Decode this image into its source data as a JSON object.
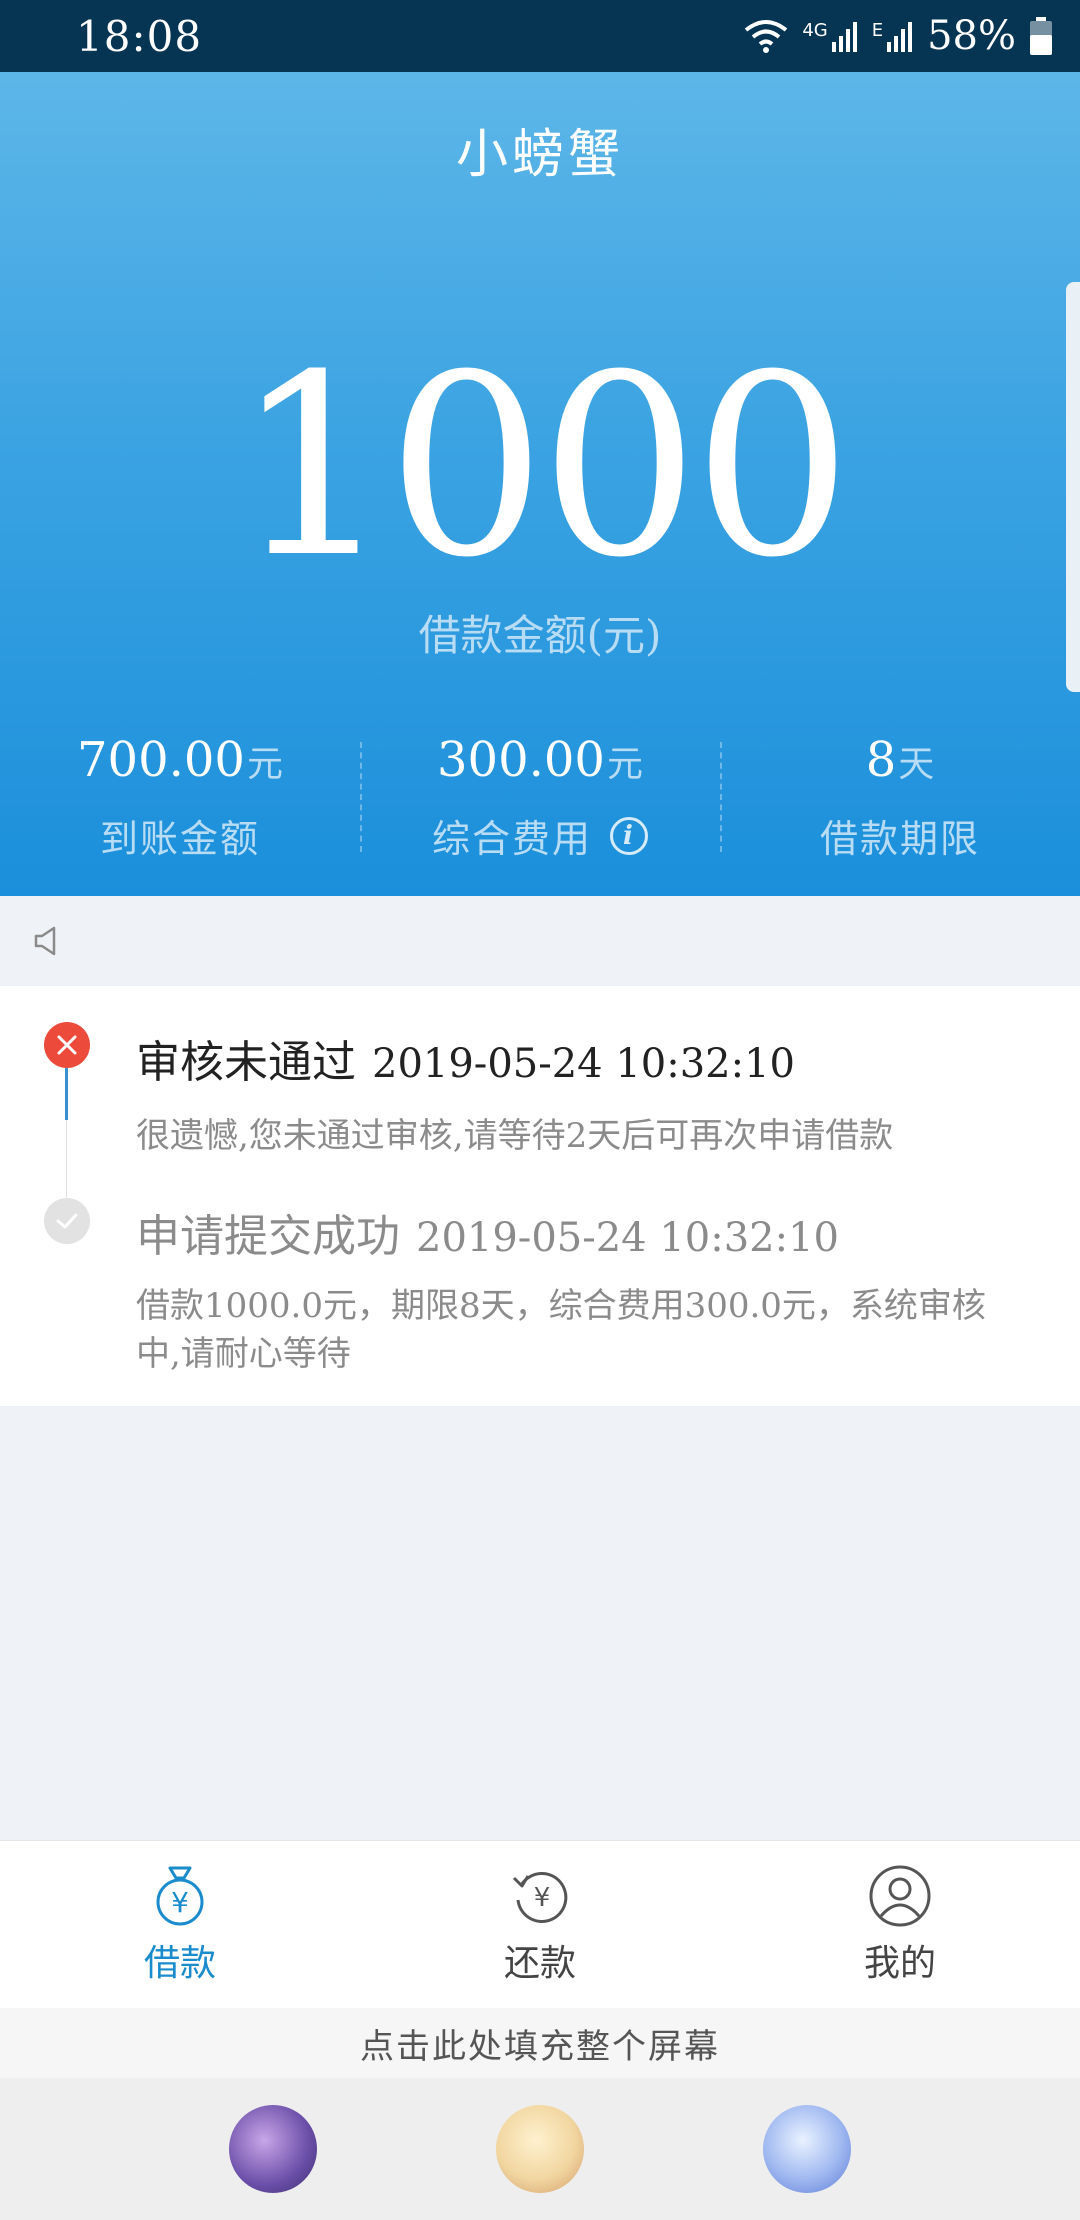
{
  "status_bar": {
    "time": "18:08",
    "network_1": "4G",
    "network_2": "E",
    "battery": "58%"
  },
  "header": {
    "app_title": "小螃蟹",
    "amount": "1000",
    "amount_label": "借款金额(元)",
    "stats": [
      {
        "value": "700.00",
        "unit": "元",
        "label": "到账金额"
      },
      {
        "value": "300.00",
        "unit": "元",
        "label": "综合费用",
        "icon": "info-icon"
      },
      {
        "value": "8",
        "unit": "天",
        "label": "借款期限"
      }
    ]
  },
  "notice": {
    "icon": "speaker-icon"
  },
  "timeline": [
    {
      "status": "fail",
      "icon": "close-icon",
      "title": "审核未通过",
      "time": "2019-05-24 10:32:10",
      "desc": "很遗憾,您未通过审核,请等待2天后可再次申请借款"
    },
    {
      "status": "done",
      "icon": "check-icon",
      "title": "申请提交成功",
      "time": "2019-05-24 10:32:10",
      "desc": "借款1000.0元，期限8天，综合费用300.0元，系统审核中,请耐心等待"
    }
  ],
  "bottom_nav": {
    "items": [
      {
        "label": "借款",
        "icon": "money-bag-icon",
        "active": true
      },
      {
        "label": "还款",
        "icon": "repay-icon",
        "active": false
      },
      {
        "label": "我的",
        "icon": "user-icon",
        "active": false
      }
    ]
  },
  "fill_banner": "点击此处填充整个屏幕",
  "colors": {
    "accent": "#1a8bcc",
    "header_top": "#5db6e8",
    "header_bottom": "#1b8fdb",
    "fail": "#ec4a3b",
    "status_bar": "#063554"
  }
}
